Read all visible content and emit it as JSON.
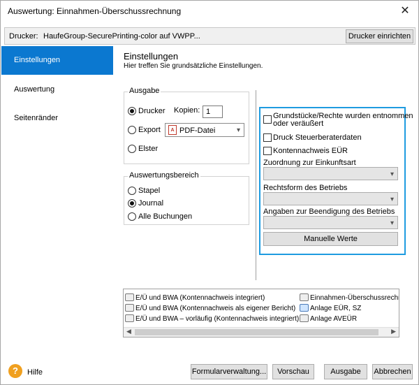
{
  "window": {
    "title": "Auswertung: Einnahmen-Überschussrechnung",
    "close_symbol": "✕"
  },
  "printer": {
    "label": "Drucker:",
    "name": "HaufeGroup-SecurePrinting-color auf VWPP...",
    "setup_button": "Drucker einrichten"
  },
  "nav": {
    "items": [
      {
        "label": "Einstellungen",
        "active": true
      },
      {
        "label": "Auswertung",
        "active": false
      },
      {
        "label": "Seitenränder",
        "active": false
      }
    ]
  },
  "content": {
    "title": "Einstellungen",
    "subtitle": "Hier treffen Sie grundsätzliche Einstellungen."
  },
  "ausgabe": {
    "legend": "Ausgabe",
    "options": [
      {
        "label": "Drucker",
        "checked": true
      },
      {
        "label": "Export",
        "checked": false
      },
      {
        "label": "Elster",
        "checked": false
      }
    ],
    "copies_label": "Kopien:",
    "copies_value": "1",
    "export_format": "PDF-Datei",
    "pdf_icon": "pdf-file-icon"
  },
  "bereich": {
    "legend": "Auswertungsbereich",
    "options": [
      {
        "label": "Stapel",
        "checked": false
      },
      {
        "label": "Journal",
        "checked": true
      },
      {
        "label": "Alle Buchungen",
        "checked": false
      }
    ]
  },
  "options": {
    "checkboxes": [
      {
        "label_line1": "Grundstücke/Rechte wurden entnommen",
        "label_line2": "oder veräußert",
        "checked": false
      },
      {
        "label": "Druck Steuerberaterdaten",
        "checked": false
      },
      {
        "label": "Kontennachweis EÜR",
        "checked": false
      }
    ],
    "zuordnung_label": "Zuordnung zur Einkunftsart",
    "zuordnung_value": "",
    "rechtsform_label": "Rechtsform des Betriebs",
    "rechtsform_value": "",
    "beendigung_label": "Angaben zur Beendigung des Betriebs",
    "beendigung_value": "",
    "manual_button": "Manuelle Werte",
    "accent_color": "#1e9be0"
  },
  "reports": {
    "col1": [
      "E/Ü und BWA (Kontennachweis integriert)",
      "E/Ü und BWA (Kontennachweis als eigener Bericht)",
      "E/Ü und BWA – vorläufig (Kontennachweis integriert)"
    ],
    "col2": [
      "Einnahmen-Überschussrechnu",
      "Anlage EÜR, SZ",
      "Anlage AVEÜR"
    ]
  },
  "footer": {
    "help_label": "Hilfe",
    "help_icon": "question-icon",
    "buttons": {
      "formulare": "Formularverwaltung...",
      "vorschau": "Vorschau",
      "ausgabe": "Ausgabe",
      "abbrechen": "Abbrechen"
    }
  }
}
